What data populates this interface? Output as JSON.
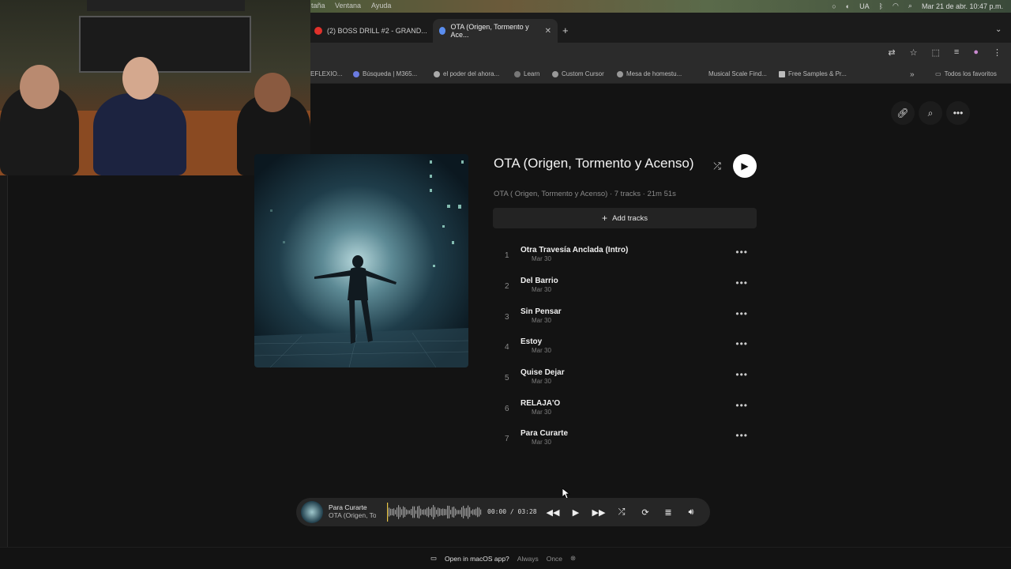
{
  "menubar": {
    "items": [
      "taña",
      "Ventana",
      "Ayuda"
    ],
    "lang": "UA",
    "datetime": "Mar 21 de abr.  10:47 p.m."
  },
  "tabs": [
    {
      "label": "(2) BOSS DRILL #2 - GRAND...",
      "favicon_color": "#e0312b"
    },
    {
      "label": "OTA (Origen, Tormento y Ace...",
      "favicon_color": "#5a8ef0"
    }
  ],
  "new_tab": "+",
  "bookmarks": [
    {
      "label": "EFLEXIO..."
    },
    {
      "label": "Búsqueda | M365..."
    },
    {
      "label": "el poder del ahora..."
    },
    {
      "label": "Learn"
    },
    {
      "label": "Custom Cursor"
    },
    {
      "label": "Mesa de homestu..."
    },
    {
      "label": "Musical Scale Find..."
    },
    {
      "label": "Free Samples & Pr..."
    }
  ],
  "bookmarks_more": "»",
  "bookmarks_all": "Todos los favoritos",
  "album": {
    "title": "OTA (Origen, Tormento y Acenso)",
    "subtitle": "OTA ( Origen, Tormento y Acenso) · 7 tracks · 21m 51s",
    "add_tracks": "Add tracks",
    "tracks": [
      {
        "num": "1",
        "name": "Otra Travesía Anclada (Intro)",
        "date": "Mar 30"
      },
      {
        "num": "2",
        "name": "Del Barrio",
        "date": "Mar 30"
      },
      {
        "num": "3",
        "name": "Sin Pensar",
        "date": "Mar 30"
      },
      {
        "num": "4",
        "name": "Estoy",
        "date": "Mar 30"
      },
      {
        "num": "5",
        "name": "Quise Dejar",
        "date": "Mar 30"
      },
      {
        "num": "6",
        "name": "RELAJA'O",
        "date": "Mar 30"
      },
      {
        "num": "7",
        "name": "Para Curarte",
        "date": "Mar 30"
      }
    ]
  },
  "player": {
    "title": "Para Curarte",
    "artist": "OTA (Origen, To",
    "time": "00:00 / 03:28",
    "progress": 0
  },
  "prompt": {
    "text": "Open in macOS app?",
    "always": "Always",
    "once": "Once"
  },
  "icons": {
    "link": "link-icon",
    "search": "search-icon",
    "more": "more-icon",
    "shuffle": "shuffle-icon",
    "play": "play-icon",
    "prev": "rewind-icon",
    "next": "fast-forward-icon",
    "repeat": "repeat-icon",
    "queue": "queue-icon",
    "volume": "volume-icon",
    "close": "close-icon",
    "laptop": "laptop-icon"
  }
}
